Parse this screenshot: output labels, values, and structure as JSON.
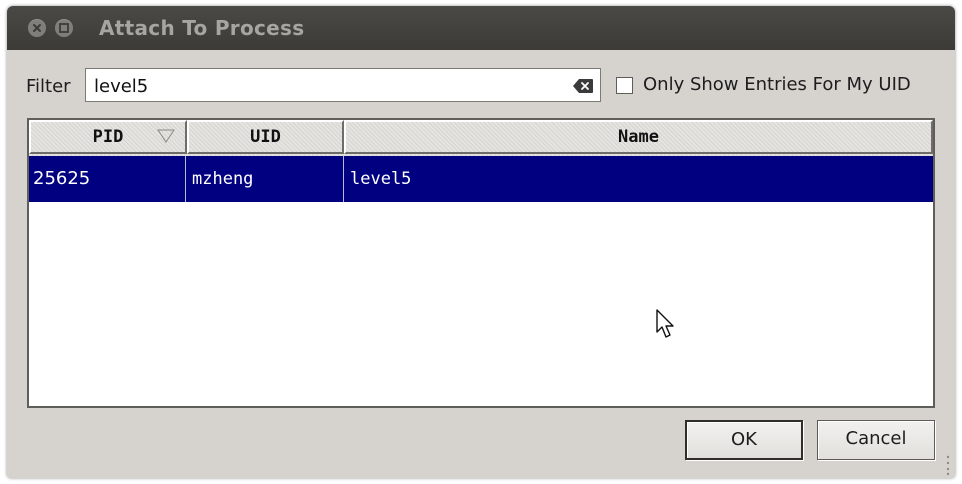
{
  "window": {
    "title": "Attach To Process"
  },
  "filter": {
    "label": "Filter",
    "value": "level5"
  },
  "only_my_uid": {
    "label": "Only Show Entries For My UID",
    "checked": false
  },
  "table": {
    "columns": [
      "PID",
      "UID",
      "Name"
    ],
    "sort_column": "PID",
    "rows": [
      {
        "pid": "25625",
        "uid": "mzheng",
        "name": "level5",
        "selected": true
      }
    ]
  },
  "buttons": {
    "ok": "OK",
    "cancel": "Cancel"
  },
  "colors": {
    "selection": "#000080",
    "dialog_bg": "#d6d3ce",
    "titlebar": "#3c3b37"
  },
  "icons": {
    "close": "close-icon",
    "minimize": "minimize-icon",
    "clear": "clear-text-icon",
    "sort": "sort-indicator-icon",
    "cursor": "mouse-pointer-icon"
  }
}
